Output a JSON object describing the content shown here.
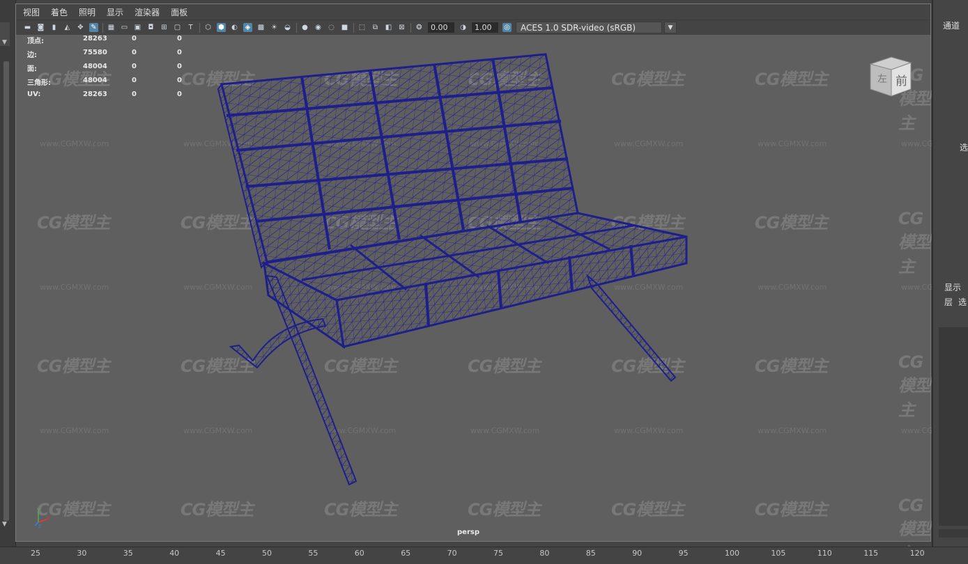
{
  "menu": [
    "视图",
    "着色",
    "照明",
    "显示",
    "渲染器",
    "面板"
  ],
  "toolbar": {
    "exposure_value": "0.00",
    "gamma_value": "1.00",
    "color_management": "ACES 1.0 SDR-video (sRGB)"
  },
  "hud": {
    "rows": [
      {
        "label": "顶点:",
        "v1": "28263",
        "v2": "0",
        "v3": "0"
      },
      {
        "label": "边:",
        "v1": "75580",
        "v2": "0",
        "v3": "0"
      },
      {
        "label": "面:",
        "v1": "48004",
        "v2": "0",
        "v3": "0"
      },
      {
        "label": "三角形:",
        "v1": "48004",
        "v2": "0",
        "v3": "0"
      },
      {
        "label": "UV:",
        "v1": "28263",
        "v2": "0",
        "v3": "0"
      }
    ]
  },
  "viewcube": {
    "front": "前",
    "left": "左"
  },
  "camera_label": "persp",
  "axis_labels": {
    "y": "y",
    "x": "x",
    "z": "z"
  },
  "watermark": {
    "logo": "CG模型主",
    "url": "www.CGMXW.com"
  },
  "ruler": [
    "25",
    "30",
    "35",
    "40",
    "45",
    "50",
    "55",
    "60",
    "65",
    "70",
    "75",
    "80",
    "85",
    "90",
    "95",
    "100",
    "105",
    "110",
    "115",
    "120"
  ],
  "right_panel": {
    "channels": "通道",
    "select": "选",
    "display_tab": "显示",
    "layers": "层",
    "layer_select": "选"
  },
  "colors": {
    "wireframe": "#1f1f8a",
    "viewport_bg": "#5f5f5f",
    "active_icon": "#5285a6"
  }
}
